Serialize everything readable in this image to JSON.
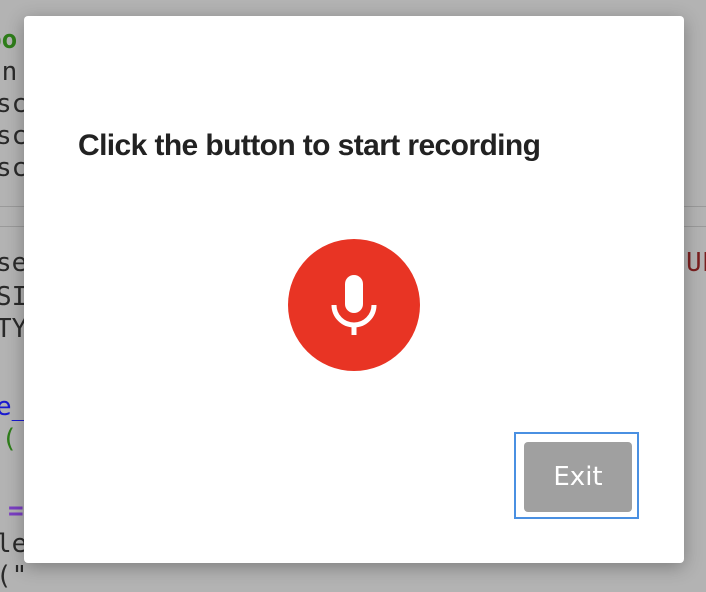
{
  "background_code": {
    "lines": [
      "po",
      "on",
      "sc",
      "sc",
      "sc",
      "se",
      "SI",
      "TY",
      "e_",
      "n(",
      "=",
      "le",
      "(\"",
      "UF"
    ],
    "colors": {
      "green": "#2e7d1a",
      "blue": "#1a1ad0",
      "purple": "#7b3fc4",
      "red": "#7a1f1f"
    }
  },
  "dialog": {
    "title": "Click the button to start recording",
    "record_button": {
      "icon": "microphone-icon",
      "color": "#e83424"
    },
    "exit_label": "Exit",
    "exit_color": "#a0a0a0",
    "focus_color": "#4a90e2"
  }
}
